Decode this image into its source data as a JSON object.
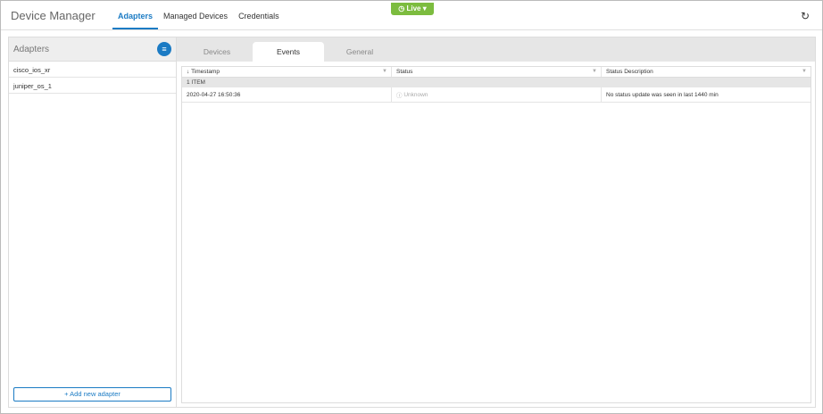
{
  "header": {
    "title": "Device Manager",
    "nav": [
      "Adapters",
      "Managed Devices",
      "Credentials"
    ],
    "live": "Live"
  },
  "left": {
    "title": "Adapters",
    "items": [
      "cisco_ios_xr",
      "juniper_os_1"
    ],
    "add": "Add new adapter"
  },
  "tabs": [
    "Devices",
    "Events",
    "General"
  ],
  "grid": {
    "columns": [
      "Timestamp",
      "Status",
      "Status Description"
    ],
    "group": "1 ITEM",
    "rows": [
      {
        "timestamp": "2020-04-27 16:50:36",
        "status": "Unknown",
        "description": "No status update was seen in last 1440 min"
      }
    ]
  }
}
